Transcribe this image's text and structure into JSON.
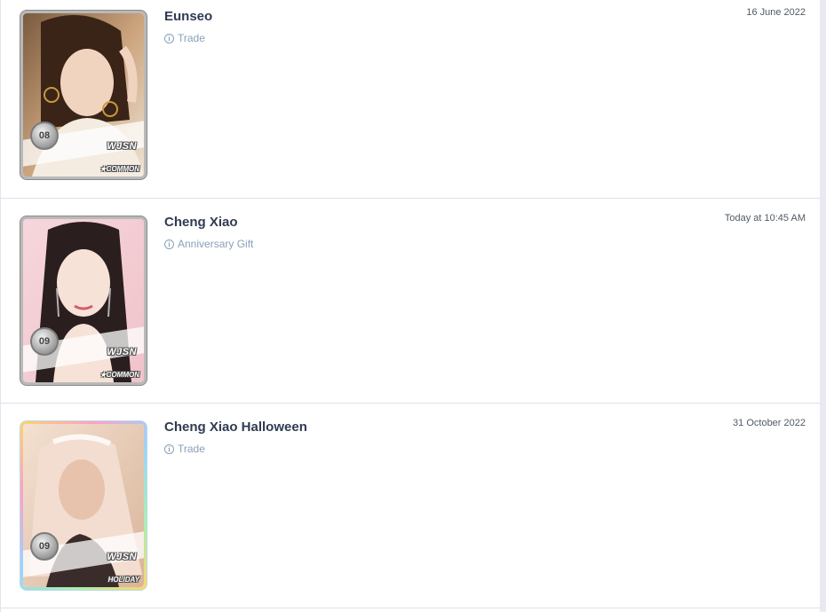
{
  "cards": [
    {
      "name": "Eunseo",
      "source": "Trade",
      "date": "16 June 2022",
      "number": "08",
      "group": "WJSN",
      "rarity": "★COMMON",
      "border_color": "#b9b9b9",
      "bg_colors": [
        "#c9a27a",
        "#ead7c1",
        "#6b4a36"
      ],
      "icon": "info-icon"
    },
    {
      "name": "Cheng Xiao",
      "source": "Anniversary Gift",
      "date": "Today at 10:45 AM",
      "number": "09",
      "group": "WJSN",
      "rarity": "★COMMON",
      "border_color": "#b9b9b9",
      "bg_colors": [
        "#f3c8cf",
        "#f4dada",
        "#3a2a2a"
      ],
      "icon": "info-icon"
    },
    {
      "name": "Cheng Xiao Halloween",
      "source": "Trade",
      "date": "31 October 2022",
      "number": "09",
      "group": "WJSN",
      "rarity": "HOLIDAY",
      "border_color": "holographic",
      "bg_colors": [
        "#e8cdb6",
        "#f2e1d3",
        "#c9a68a"
      ],
      "icon": "info-icon"
    }
  ]
}
